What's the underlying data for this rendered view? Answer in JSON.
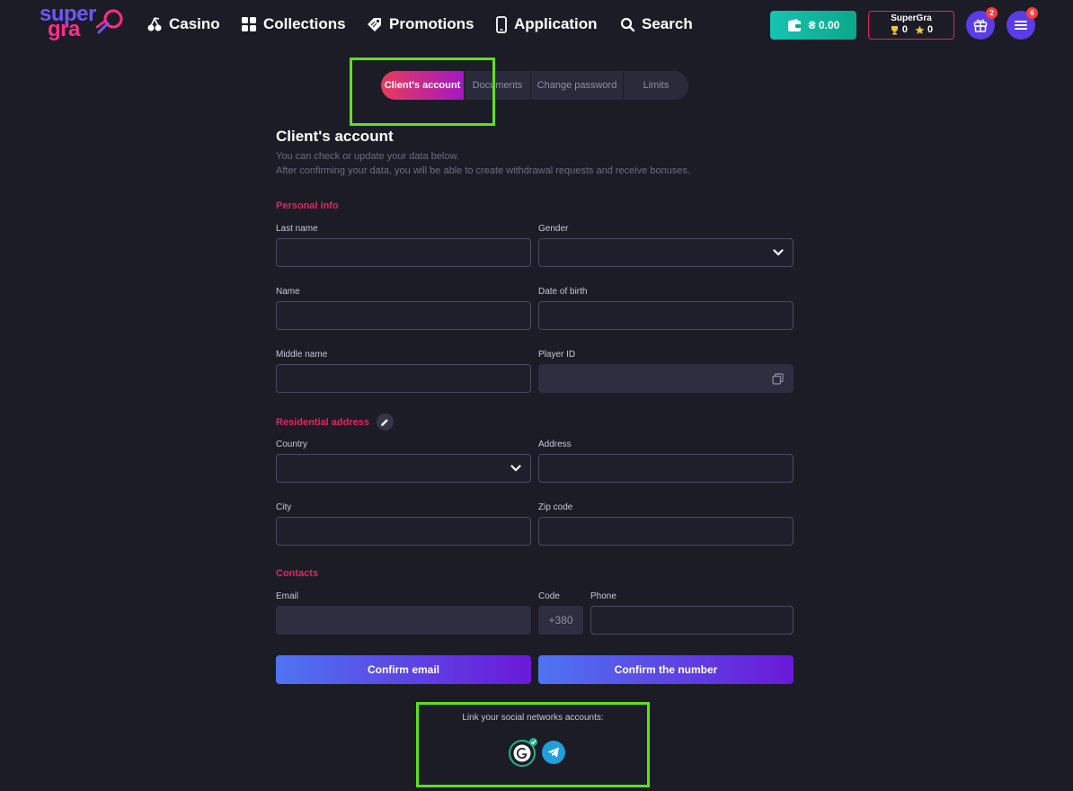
{
  "header": {
    "logo_line1": "super",
    "logo_line2": "gra",
    "nav": [
      {
        "label": "Casino",
        "icon": "cherries-icon"
      },
      {
        "label": "Collections",
        "icon": "grid-icon"
      },
      {
        "label": "Promotions",
        "icon": "tag-icon"
      },
      {
        "label": "Application",
        "icon": "phone-icon"
      },
      {
        "label": "Search",
        "icon": "search-icon"
      }
    ],
    "wallet_balance": "₴ 0.00",
    "username": "SuperGra",
    "trophies": "0",
    "stars": "0",
    "gift_badge": "2",
    "menu_badge": "6"
  },
  "tabs": [
    {
      "label": "Client's account",
      "active": true
    },
    {
      "label": "Documents",
      "active": false
    },
    {
      "label": "Change password",
      "active": false
    },
    {
      "label": "Limits",
      "active": false
    }
  ],
  "page": {
    "title": "Client's account",
    "subtitle1": "You can check or update your data below.",
    "subtitle2": "After confirming your data, you will be able to create withdrawal requests and receive bonuses."
  },
  "personal": {
    "title": "Personal info",
    "last_name": "Last name",
    "gender": "Gender",
    "name": "Name",
    "dob": "Date of birth",
    "middle_name": "Middle name",
    "player_id": "Player ID"
  },
  "address": {
    "title": "Residential address",
    "country": "Country",
    "address": "Address",
    "city": "City",
    "zip": "Zip code"
  },
  "contacts": {
    "title": "Contacts",
    "email": "Email",
    "code": "Code",
    "phone": "Phone",
    "code_value": "+380"
  },
  "buttons": {
    "confirm_email": "Confirm email",
    "confirm_number": "Confirm the number"
  },
  "social": {
    "text": "Link your social networks accounts:"
  },
  "colors": {
    "accent": "#e2245d",
    "highlight": "#5fe01c",
    "wallet": "#17c3b2"
  }
}
